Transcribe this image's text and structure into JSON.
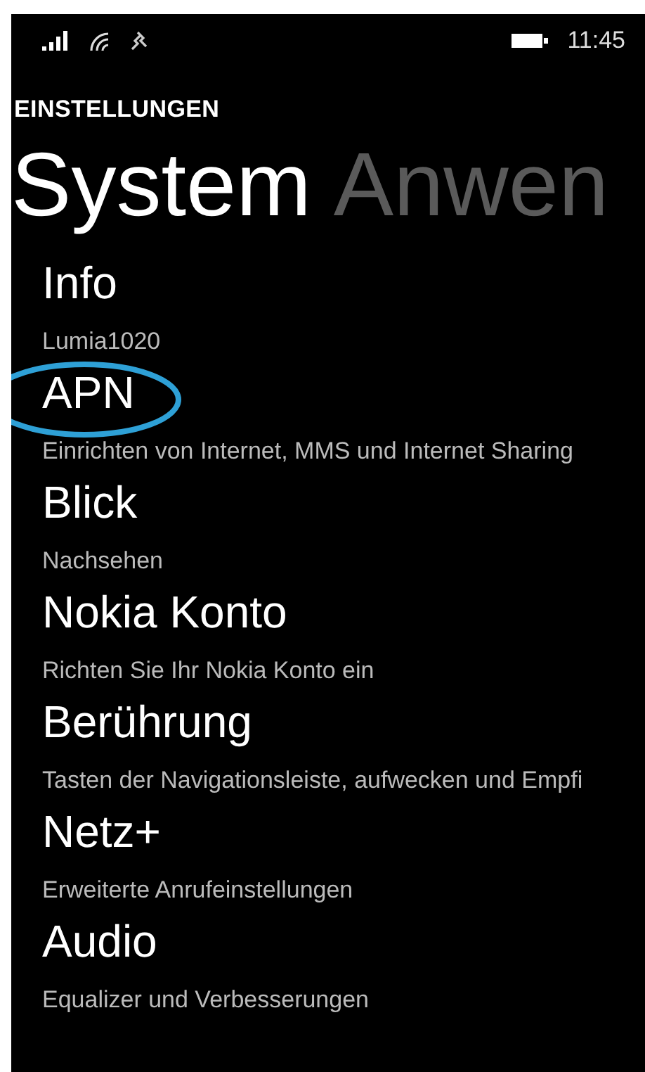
{
  "status_bar": {
    "time": "11:45"
  },
  "header": "EINSTELLUNGEN",
  "pivot": [
    {
      "label": "System",
      "selected": true
    },
    {
      "label": "Anwen",
      "selected": false
    }
  ],
  "items": [
    {
      "title": "Info",
      "subtitle": "Lumia1020"
    },
    {
      "title": "APN",
      "subtitle": "Einrichten von Internet, MMS und Internet Sharing"
    },
    {
      "title": "Blick",
      "subtitle": "Nachsehen"
    },
    {
      "title": "Nokia Konto",
      "subtitle": "Richten Sie Ihr Nokia Konto ein"
    },
    {
      "title": "Berührung",
      "subtitle": "Tasten der Navigationsleiste, aufwecken und Empfi"
    },
    {
      "title": "Netz+",
      "subtitle": "Erweiterte Anrufeinstellungen"
    },
    {
      "title": "Audio",
      "subtitle": "Equalizer und Verbesserungen"
    }
  ]
}
